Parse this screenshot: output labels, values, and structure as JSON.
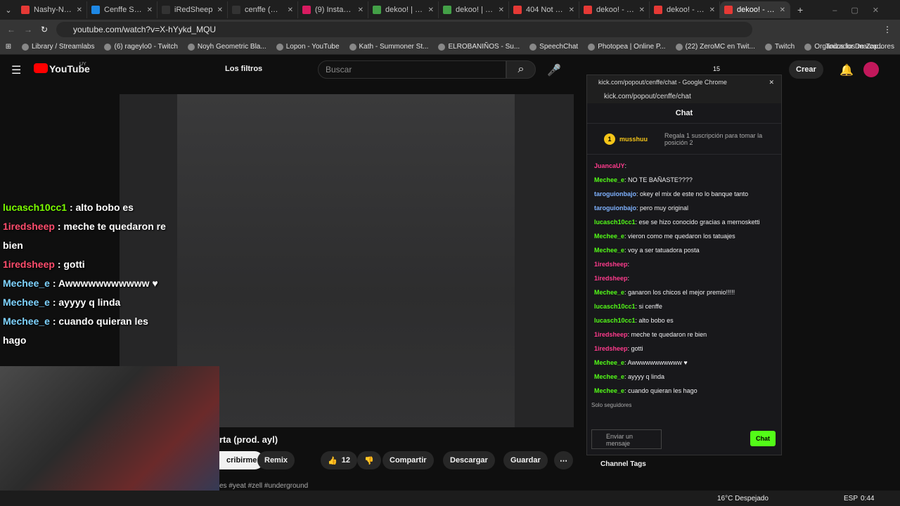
{
  "tabs": [
    {
      "label": "Nashy-Nashai",
      "color": "#e53935"
    },
    {
      "label": "Cenffe Stream",
      "color": "#1e88e5"
    },
    {
      "label": "iRedSheep",
      "color": "#333"
    },
    {
      "label": "cenffe (@cenffe)",
      "color": "#333"
    },
    {
      "label": "(9) Instagram",
      "color": "#d81b60"
    },
    {
      "label": "dekoo! | Instagram",
      "color": "#43a047"
    },
    {
      "label": "dekoo! | Spotify",
      "color": "#43a047"
    },
    {
      "label": "404 Not Found",
      "color": "#e53935"
    },
    {
      "label": "dekoo! - llorar",
      "color": "#e53935"
    },
    {
      "label": "dekoo! - YouTube",
      "color": "#e53935"
    },
    {
      "label": "dekoo! - Ya no",
      "color": "#e53935",
      "active": true
    }
  ],
  "url": "youtube.com/watch?v=X-hYykd_MQU",
  "bookmarks": [
    "Library / Streamlabs",
    "(6) rageylo0 - Twitch",
    "Noyh Geometric Bla...",
    "Lopon - YouTube",
    "Kath - Summoner St...",
    "ELROBANIÑOS - Su...",
    "SpeechChat",
    "Photopea | Online P...",
    "(22) ZeroMC en Twit...",
    "Twitch",
    "Organizador De Zap..."
  ],
  "bookmarks_all": "Todos los marcadores",
  "yt": {
    "logo": "YouTube",
    "country": "UY",
    "filters": "Los filtros",
    "search_placeholder": "Buscar",
    "notif_count": "15",
    "create": "Crear"
  },
  "overlay_chat": [
    {
      "user": "lucasch10cc1",
      "text": " : alto bobo es",
      "ucolor": "#7cfc00"
    },
    {
      "user": "1iredsheep",
      "text": " : meche te quedaron re bien",
      "ucolor": "#ff4d6d"
    },
    {
      "user": "1iredsheep",
      "text": " : gotti",
      "ucolor": "#ff4d6d"
    },
    {
      "user": "Mechee_e",
      "text": " : Awwwwwwwwwww ♥",
      "ucolor": "#7fd4ff"
    },
    {
      "user": "Mechee_e",
      "text": " : ayyyy q linda",
      "ucolor": "#7fd4ff"
    },
    {
      "user": "Mechee_e",
      "text": " : cuando quieran les hago",
      "ucolor": "#7fd4ff"
    }
  ],
  "video_title": "rta (prod. ayl)",
  "actions": {
    "subscribe": "cribirme",
    "remix": "Remix",
    "likes": "12",
    "share": "Compartir",
    "download": "Descargar",
    "save": "Guardar"
  },
  "tags": "es #yeat #zell #underground",
  "popup": {
    "window_title": "kick.com/popout/cenffe/chat - Google Chrome",
    "url": "kick.com/popout/cenffe/chat",
    "heading": "Chat",
    "top_user": "musshuu",
    "top_rank": "1",
    "top_msg": "Regala 1 suscripción para tomar la posición 2",
    "messages": [
      {
        "user": "JuancaUY",
        "text": ":",
        "c": "#ff3b8d"
      },
      {
        "user": "Mechee_e",
        "text": ": NO TE BAÑASTE????",
        "c": "#53fc18"
      },
      {
        "user": "taroguionbajo",
        "text": ": okey el mix de este no lo banque tanto",
        "c": "#7fb2ff"
      },
      {
        "user": "taroguionbajo",
        "text": ": pero muy original",
        "c": "#7fb2ff"
      },
      {
        "user": "lucasch10cc1",
        "text": ": ese se hizo conocido gracias a mernosketti",
        "c": "#53fc18"
      },
      {
        "user": "Mechee_e",
        "text": ": vieron como me quedaron los tatuajes",
        "c": "#53fc18"
      },
      {
        "user": "Mechee_e",
        "text": ": voy a ser tatuadora posta",
        "c": "#53fc18"
      },
      {
        "user": "1iredsheep",
        "text": ":",
        "c": "#ff3b8d"
      },
      {
        "user": "1iredsheep",
        "text": ":",
        "c": "#ff3b8d"
      },
      {
        "user": "Mechee_e",
        "text": ": ganaron los chicos el mejor premio!!!!!",
        "c": "#53fc18"
      },
      {
        "user": "lucasch10cc1",
        "text": ": si cenffe",
        "c": "#53fc18"
      },
      {
        "user": "lucasch10cc1",
        "text": ": alto bobo es",
        "c": "#53fc18"
      },
      {
        "user": "1iredsheep",
        "text": ": meche te quedaron re bien",
        "c": "#ff3b8d"
      },
      {
        "user": "1iredsheep",
        "text": ": gotti",
        "c": "#ff3b8d"
      },
      {
        "user": "Mechee_e",
        "text": ": Awwwwwwwwwww ♥",
        "c": "#53fc18"
      },
      {
        "user": "Mechee_e",
        "text": ": ayyyy q linda",
        "c": "#53fc18"
      },
      {
        "user": "Mechee_e",
        "text": ": cuando quieran les hago",
        "c": "#53fc18"
      }
    ],
    "followers_only": "Solo seguidores",
    "input_placeholder": "Enviar un mensaje",
    "send": "Chat",
    "channel_tags": "Channel Tags"
  },
  "taskbar": {
    "weather": "16°C Despejado",
    "lang": "ESP",
    "time": "0:44"
  }
}
